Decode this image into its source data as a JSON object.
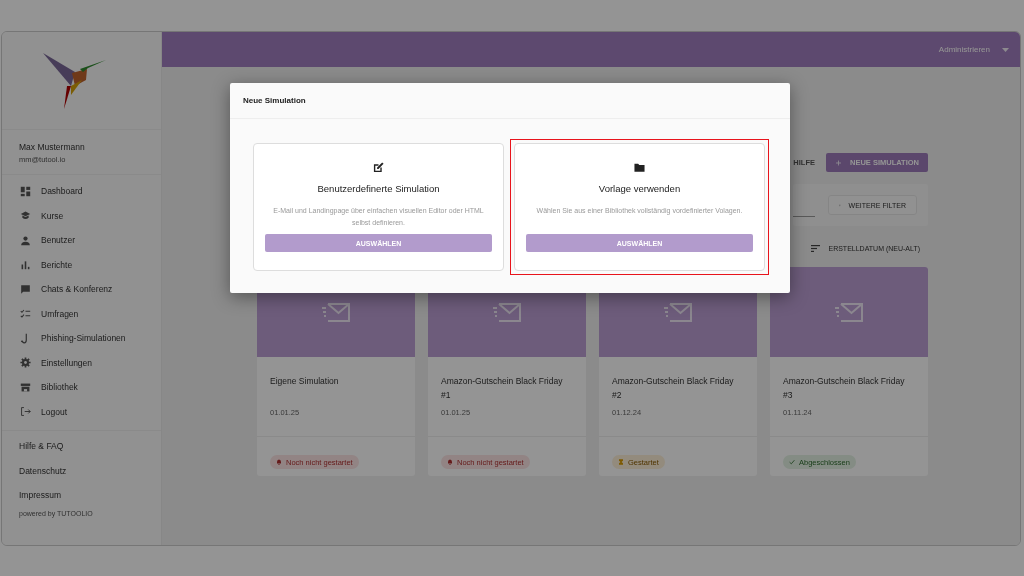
{
  "sidebar": {
    "user": {
      "name": "Max Mustermann",
      "email": "mm@tutool.io"
    },
    "items": [
      {
        "label": "Dashboard"
      },
      {
        "label": "Kurse"
      },
      {
        "label": "Benutzer"
      },
      {
        "label": "Berichte"
      },
      {
        "label": "Chats & Konferenz"
      },
      {
        "label": "Umfragen"
      },
      {
        "label": "Phishing-Simulationen"
      },
      {
        "label": "Einstellungen"
      },
      {
        "label": "Bibliothek"
      },
      {
        "label": "Logout"
      }
    ],
    "links": [
      "Hilfe & FAQ",
      "Datenschutz",
      "Impressum"
    ],
    "footer": "powered by TUTOOLIO"
  },
  "topbar": {
    "menu": "Administrieren"
  },
  "toolbar": {
    "help": "HILFE",
    "new_button": "NEUE SIMULATION",
    "filter_button": "WEITERE FILTER",
    "sort": "ERSTELLDATUM (NEU-ALT)"
  },
  "cards": [
    {
      "title": "Eigene Simulation",
      "date": "01.01.25",
      "status": {
        "kind": "not_started",
        "label": "Noch nicht gestartet"
      }
    },
    {
      "title": "Amazon-Gutschein Black Friday #1",
      "date": "01.01.25",
      "status": {
        "kind": "not_started",
        "label": "Noch nicht gestartet"
      }
    },
    {
      "title": "Amazon-Gutschein Black Friday #2",
      "date": "01.12.24",
      "status": {
        "kind": "started",
        "label": "Gestartet"
      }
    },
    {
      "title": "Amazon-Gutschein Black Friday #3",
      "date": "01.11.24",
      "status": {
        "kind": "done",
        "label": "Abgeschlossen"
      }
    }
  ],
  "dialog": {
    "title": "Neue Simulation",
    "options": [
      {
        "kind": "edit",
        "title": "Benutzerdefinerte Simulation",
        "description": "E-Mail und Landingpage über einfachen visuellen Editor oder HTML selbst definieren.",
        "button": "AUSWÄHLEN",
        "highlighted": false
      },
      {
        "kind": "folder",
        "title": "Vorlage verwenden",
        "description": "Wählen Sie aus einer Bibliothek vollständig vordefinierter Volagen.",
        "button": "AUSWÄHLEN",
        "highlighted": true
      }
    ]
  }
}
